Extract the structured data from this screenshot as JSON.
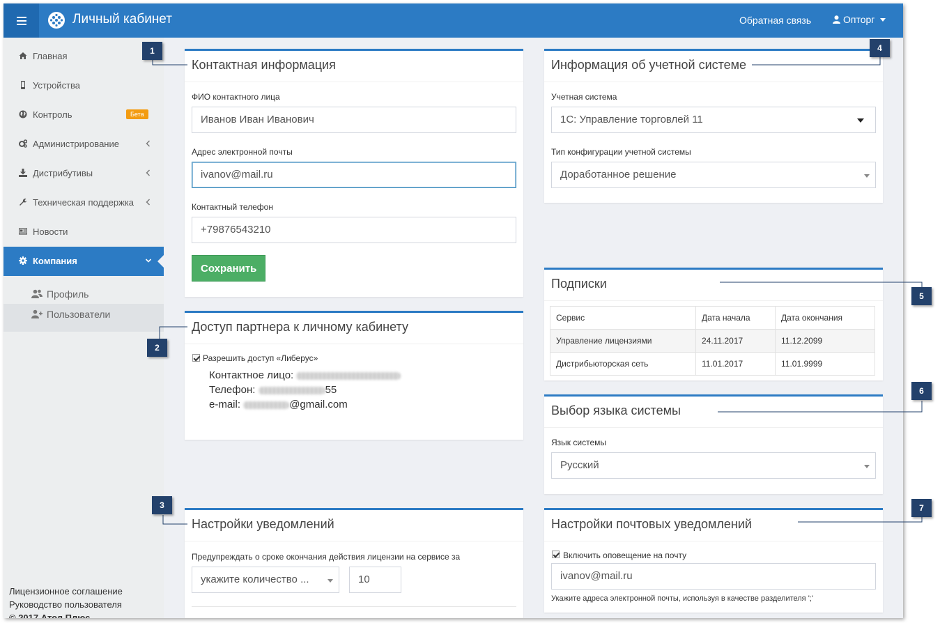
{
  "header": {
    "title": "Личный кабинет",
    "feedback": "Обратная связь",
    "user": "Опторг",
    "colors": {
      "primary": "#2c7bc4",
      "menu_button": "#1f69b0"
    }
  },
  "sidebar": {
    "items": [
      {
        "label": "Главная",
        "icon": "home-icon"
      },
      {
        "label": "Устройства",
        "icon": "mobile-icon"
      },
      {
        "label": "Контроль",
        "icon": "globe-icon",
        "badge": "Бета"
      },
      {
        "label": "Администрирование",
        "icon": "cogs-icon"
      },
      {
        "label": "Дистрибутивы",
        "icon": "download-icon"
      },
      {
        "label": "Техническая поддержка",
        "icon": "wrench-icon"
      },
      {
        "label": "Новости",
        "icon": "newspaper-icon"
      },
      {
        "label": "Компания",
        "icon": "gear-icon"
      }
    ],
    "subitems": [
      {
        "label": "Профиль",
        "icon": "users-icon"
      },
      {
        "label": "Пользователи",
        "icon": "user-plus-icon"
      }
    ],
    "footer": {
      "license": "Лицензионное соглашение",
      "guide": "Руководство пользователя",
      "copyright": "© 2017 Атол Плюс"
    }
  },
  "contact": {
    "title": "Контактная информация",
    "name_label": "ФИО контактного лица",
    "name_value": "Иванов Иван Иванович",
    "email_label": "Адрес электронной почты",
    "email_value": "ivanov@mail.ru",
    "phone_label": "Контактный телефон",
    "phone_value": "+79876543210",
    "save_label": "Сохранить"
  },
  "partner": {
    "title": "Доступ партнера к личному кабинету",
    "allow_label": "Разрешить доступ «Либерус»",
    "contact_label": "Контактное лицо:",
    "phone_label": "Телефон:",
    "phone_suffix": "55",
    "email_label": "e-mail:",
    "email_suffix": "@gmail.com"
  },
  "notifications": {
    "title": "Настройки уведомлений",
    "warn_label": "Предупреждать о сроке окончания действия лицензии на сервисе за",
    "select_value": "укажите количество ...",
    "number_value": "10"
  },
  "accounting": {
    "title": "Информация об учетной системе",
    "system_label": "Учетная система",
    "system_value": "1С: Управление торговлей 11",
    "config_label": "Тип конфигурации учетной системы",
    "config_value": "Доработанное решение"
  },
  "subscriptions": {
    "title": "Подписки",
    "columns": [
      "Сервис",
      "Дата начала",
      "Дата окончания"
    ],
    "rows": [
      [
        "Управление лицензиями",
        "24.11.2017",
        "11.12.2099"
      ],
      [
        "Дистрибьюторская сеть",
        "11.01.2017",
        "11.01.9999"
      ]
    ]
  },
  "language": {
    "title": "Выбор языка системы",
    "label": "Язык системы",
    "value": "Русский"
  },
  "mail": {
    "title": "Настройки почтовых уведомлений",
    "enable_label": "Включить оповещение на почту",
    "email_value": "ivanov@mail.ru",
    "hint": "Укажите адреса электронной почты, используя в качестве разделителя ';'"
  },
  "callouts": [
    "1",
    "2",
    "3",
    "4",
    "5",
    "6",
    "7"
  ]
}
